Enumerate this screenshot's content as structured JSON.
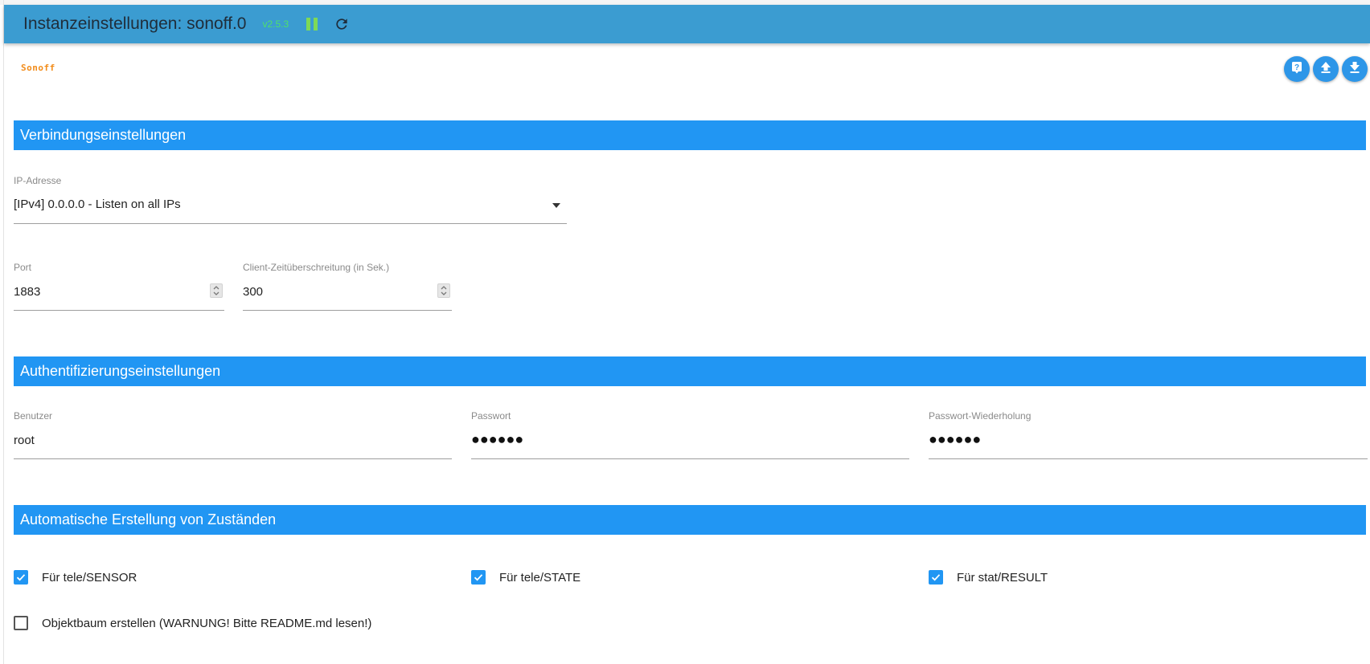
{
  "header": {
    "title": "Instanzeinstellungen: sonoff.0",
    "version": "v2.5.3",
    "pause_icon": "pause-icon",
    "reload_icon": "reload-icon"
  },
  "logo": {
    "text": "Sonoff"
  },
  "actions": [
    {
      "name": "help-button",
      "icon": "help-icon"
    },
    {
      "name": "upload-button",
      "icon": "upload-icon"
    },
    {
      "name": "download-button",
      "icon": "download-icon"
    }
  ],
  "sections": {
    "connection": {
      "title": "Verbindungseinstellungen",
      "ip": {
        "label": "IP-Adresse",
        "value": "[IPv4] 0.0.0.0 - Listen on all IPs"
      },
      "port": {
        "label": "Port",
        "value": "1883"
      },
      "timeout": {
        "label": "Client-Zeitüberschreitung (in Sek.)",
        "value": "300"
      }
    },
    "auth": {
      "title": "Authentifizierungseinstellungen",
      "user": {
        "label": "Benutzer",
        "value": "root"
      },
      "password": {
        "label": "Passwort",
        "value": "●●●●●●"
      },
      "password_repeat": {
        "label": "Passwort-Wiederholung",
        "value": "●●●●●●"
      }
    },
    "states": {
      "title": "Automatische Erstellung von Zuständen",
      "options": [
        {
          "label": "Für tele/SENSOR",
          "checked": true
        },
        {
          "label": "Für tele/STATE",
          "checked": true
        },
        {
          "label": "Für stat/RESULT",
          "checked": true
        },
        {
          "label": "Objektbaum erstellen (WARNUNG! Bitte README.md lesen!)",
          "checked": false
        }
      ]
    }
  },
  "colors": {
    "titlebar": "#3b9cd1",
    "section": "#2196f3",
    "accent": "#2196f3",
    "version": "#4ee06a",
    "pause": "#7ed957",
    "logo": "#f28c1a"
  }
}
